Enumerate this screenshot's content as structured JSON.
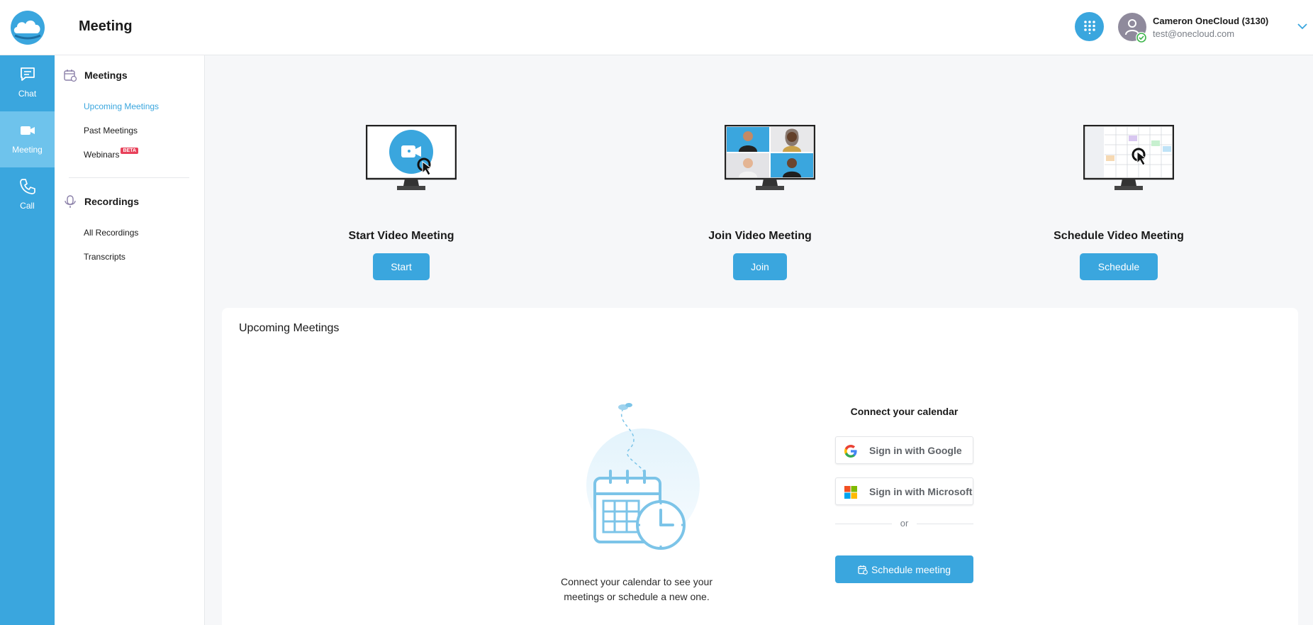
{
  "header": {
    "title": "Meeting",
    "user": {
      "name": "Cameron OneCloud (3130)",
      "email": "test@onecloud.com"
    }
  },
  "rail": {
    "items": [
      {
        "label": "Chat",
        "icon": "chat-icon"
      },
      {
        "label": "Meeting",
        "icon": "video-camera-icon",
        "active": true
      },
      {
        "label": "Call",
        "icon": "phone-icon"
      }
    ]
  },
  "subnav": {
    "meetings": {
      "title": "Meetings",
      "items": [
        {
          "label": "Upcoming Meetings",
          "active": true
        },
        {
          "label": "Past Meetings"
        },
        {
          "label": "Webinars",
          "badge": "BETA"
        }
      ]
    },
    "recordings": {
      "title": "Recordings",
      "items": [
        {
          "label": "All Recordings"
        },
        {
          "label": "Transcripts"
        }
      ]
    }
  },
  "hero": {
    "start": {
      "title": "Start Video Meeting",
      "button": "Start"
    },
    "join": {
      "title": "Join Video Meeting",
      "button": "Join"
    },
    "schedule": {
      "title": "Schedule Video Meeting",
      "button": "Schedule"
    }
  },
  "upcoming": {
    "title": "Upcoming Meetings",
    "empty_text": "Connect your calendar to see your meetings or schedule a new one.",
    "connect_title": "Connect your calendar",
    "google_label": "Sign in with Google",
    "microsoft_label": "Sign in with Microsoft",
    "or_label": "or",
    "schedule_label": "Schedule meeting"
  },
  "colors": {
    "accent": "#3aa6de",
    "rail_active": "#6ec3ec",
    "beta": "#e8415a"
  }
}
